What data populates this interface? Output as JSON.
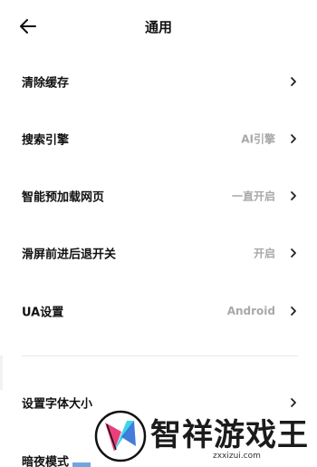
{
  "header": {
    "title": "通用"
  },
  "rows": [
    {
      "label": "清除缓存",
      "value": ""
    },
    {
      "label": "搜索引擎",
      "value": "AI引擎"
    },
    {
      "label": "智能预加载网页",
      "value": "一直开启"
    },
    {
      "label": "滑屏前进后退开关",
      "value": "开启"
    },
    {
      "label": "UA设置",
      "value": "Android"
    },
    {
      "label": "设置字体大小",
      "value": ""
    },
    {
      "label": "暗夜模式",
      "value": ""
    }
  ],
  "watermark": {
    "name": "智祥游戏王",
    "url": "zxxizui.com"
  },
  "colors": {
    "logo_pink": "#e8407a",
    "logo_cyan": "#3fd4e6",
    "logo_blue": "#2d6fd8"
  }
}
